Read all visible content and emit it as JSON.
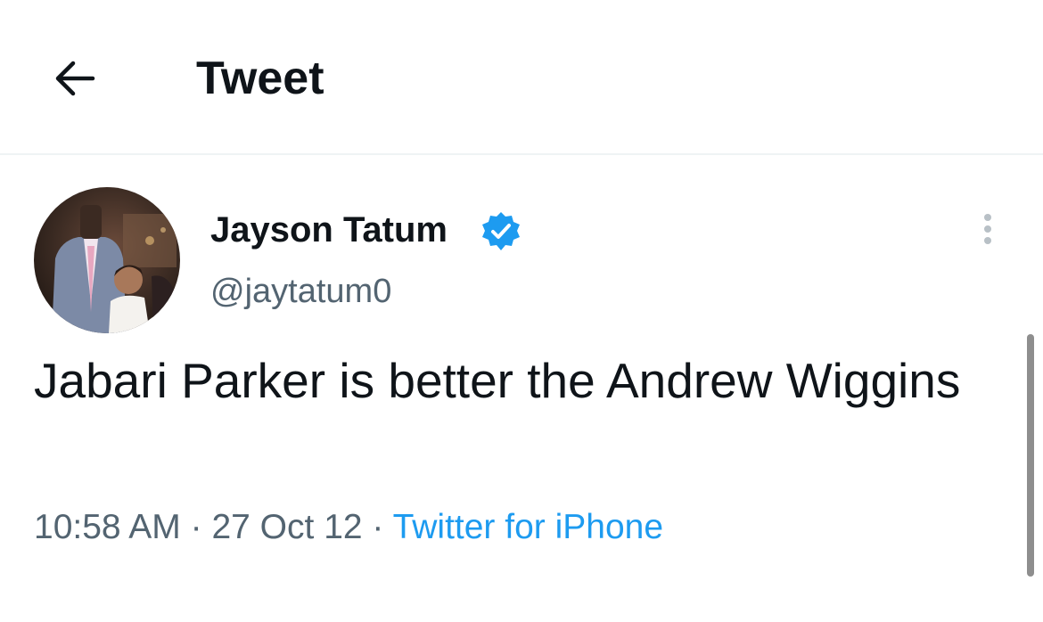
{
  "header": {
    "title": "Tweet",
    "back_icon": "arrow-left-icon"
  },
  "tweet": {
    "author": {
      "display_name": "Jayson Tatum",
      "handle": "@jaytatum0",
      "verified": true,
      "verified_color": "#1d9bf0"
    },
    "text": "Jabari Parker is better the Andrew Wiggins",
    "time": "10:58 AM",
    "date": "27 Oct 12",
    "separator": "·",
    "source": "Twitter for iPhone",
    "more_icon": "more-vertical-icon"
  },
  "colors": {
    "text_primary": "#0f1419",
    "text_secondary": "#536471",
    "link": "#1d9bf0",
    "divider": "#eff3f4"
  }
}
